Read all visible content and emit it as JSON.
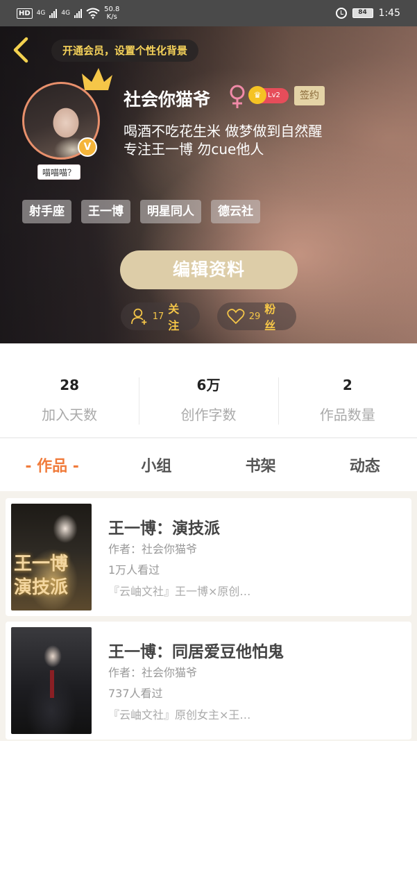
{
  "status_bar": {
    "hd": "HD",
    "net1": "4G",
    "net2": "4G",
    "speed_value": "50.8",
    "speed_unit": "K/s",
    "battery": "84",
    "time": "1:45"
  },
  "header": {
    "vip_banner": "开通会员，设置个性化背景"
  },
  "profile": {
    "nickname": "社会你猫爷",
    "gender_icon": "female-symbol",
    "level": "Lv2",
    "sign_badge": "签约",
    "avatar_tag": "喵喵喵？",
    "verified_badge": "V",
    "bio_line1": "喝酒不吃花生米 做梦做到自然醒",
    "bio_line2": "专注王一博 勿cue他人",
    "tags": [
      "射手座",
      "王一博",
      "明星同人",
      "德云社"
    ],
    "edit_button": "编辑资料",
    "following_count": "17",
    "following_label": "关注",
    "fans_count": "29",
    "fans_label": "粉丝"
  },
  "stats": [
    {
      "value": "28",
      "label": "加入天数"
    },
    {
      "value": "6万",
      "label": "创作字数"
    },
    {
      "value": "2",
      "label": "作品数量"
    }
  ],
  "tabs": [
    {
      "label": "- 作品 -",
      "active": true
    },
    {
      "label": "小组",
      "active": false
    },
    {
      "label": "书架",
      "active": false
    },
    {
      "label": "动态",
      "active": false
    }
  ],
  "works": [
    {
      "title": "王一博：演技派",
      "author": "作者：社会你猫爷",
      "views": "1万人看过",
      "desc": "『云岫文社』王一博×原创…",
      "cover_text": "王一博\n演技派"
    },
    {
      "title": "王一博：同居爱豆他怕鬼",
      "author": "作者：社会你猫爷",
      "views": "737人看过",
      "desc": "『云岫文社』原创女主×王…"
    }
  ],
  "colors": {
    "accent_orange": "#f07c3c",
    "gold": "#f5c648",
    "edit_button_bg": "#ddcda8",
    "level_red": "#e64d5a"
  }
}
